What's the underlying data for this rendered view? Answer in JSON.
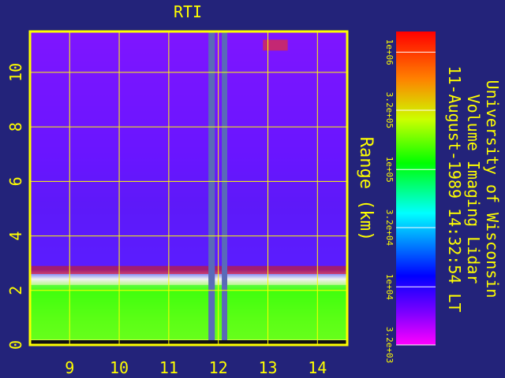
{
  "chart_data": {
    "type": "heatmap",
    "title": "RTI",
    "ylabel": "Range (km)",
    "xlabel": "",
    "xlim": [
      8.2,
      14.6
    ],
    "ylim": [
      0,
      11.5
    ],
    "x_ticks": [
      {
        "value": 9,
        "label": "9"
      },
      {
        "value": 10,
        "label": "10"
      },
      {
        "value": 11,
        "label": "11"
      },
      {
        "value": 12,
        "label": "12"
      },
      {
        "value": 13,
        "label": "13"
      },
      {
        "value": 14,
        "label": "14"
      }
    ],
    "y_ticks": [
      {
        "value": 0,
        "label": "0"
      },
      {
        "value": 2,
        "label": "2"
      },
      {
        "value": 4,
        "label": "4"
      },
      {
        "value": 6,
        "label": "6"
      },
      {
        "value": 8,
        "label": "8"
      },
      {
        "value": 10,
        "label": "10"
      }
    ],
    "grid": true,
    "colorbar": {
      "scale": "log",
      "range": [
        3200,
        1500000
      ],
      "ticks": [
        {
          "value": 1000000,
          "label": "1e+06"
        },
        {
          "value": 320000,
          "label": "3.2e+05"
        },
        {
          "value": 100000,
          "label": "1e+05"
        },
        {
          "value": 32000,
          "label": "3.2e+04"
        },
        {
          "value": 10000,
          "label": "1e+04"
        },
        {
          "value": 3200,
          "label": "3.2e+03"
        }
      ]
    },
    "features": [
      {
        "x": [
          8.2,
          14.6
        ],
        "y": [
          2.6,
          2.9
        ],
        "level": 1500000
      },
      {
        "x": [
          8.2,
          14.6
        ],
        "y": [
          0.2,
          2.2
        ],
        "level": 120000
      },
      {
        "x": [
          8.2,
          14.6
        ],
        "y": [
          2.9,
          11.5
        ],
        "level": 6000
      },
      {
        "x": [
          12.9,
          13.4
        ],
        "y": [
          10.8,
          11.2
        ],
        "level": 1000000
      }
    ],
    "gaps_x": [
      [
        11.8,
        11.93
      ],
      [
        12.07,
        12.18
      ]
    ]
  },
  "info": {
    "line1": "University of Wisconsin",
    "line2": "Volume Imaging Lidar",
    "line3": "11-August-1989 14:32:54 LT"
  }
}
